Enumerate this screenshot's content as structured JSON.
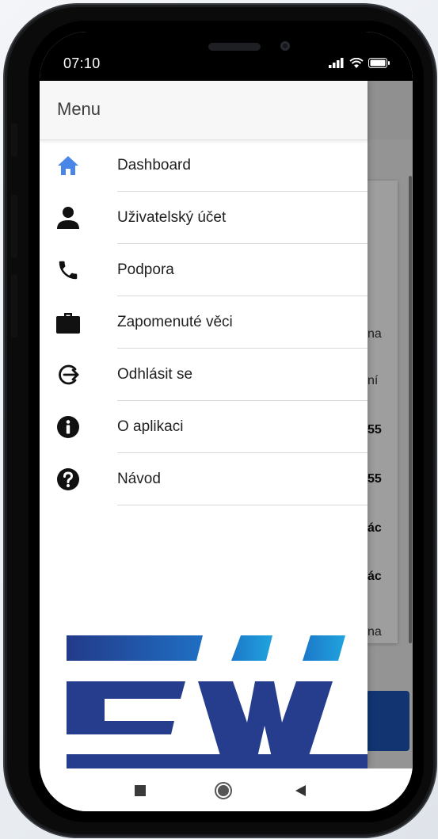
{
  "status_bar": {
    "time": "07:10"
  },
  "drawer": {
    "title": "Menu",
    "items": [
      {
        "label": "Dashboard",
        "icon": "home-icon",
        "color": "#4a86e8"
      },
      {
        "label": "Uživatelský účet",
        "icon": "person-icon",
        "color": "#111111"
      },
      {
        "label": "Podpora",
        "icon": "phone-icon",
        "color": "#111111"
      },
      {
        "label": "Zapomenuté věci",
        "icon": "briefcase-icon",
        "color": "#111111"
      },
      {
        "label": "Odhlásit se",
        "icon": "logout-icon",
        "color": "#111111"
      },
      {
        "label": "O aplikaci",
        "icon": "info-icon",
        "color": "#111111"
      },
      {
        "label": "Návod",
        "icon": "help-icon",
        "color": "#111111"
      }
    ]
  },
  "background_app": {
    "fragments": [
      "na",
      "ní",
      "55",
      "55",
      "ác",
      "ác",
      "na"
    ]
  },
  "colors": {
    "accent": "#4a86e8",
    "logo_dark_blue": "#253d8c",
    "logo_light_blue": "#1f9ad7"
  }
}
